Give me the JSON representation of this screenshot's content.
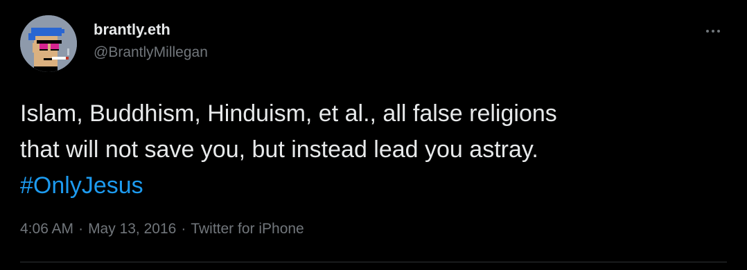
{
  "tweet": {
    "author": {
      "display_name": "brantly.eth",
      "handle": "@BrantlyMillegan",
      "avatar_icon": "pixel-punk-avatar-icon"
    },
    "more_icon": "more-horizontal-icon",
    "text_lines": [
      "Islam, Buddhism, Hinduism, et al., all false religions",
      "that will not save you, but instead lead you astray."
    ],
    "hashtag": "#OnlyJesus",
    "meta": {
      "time": "4:06 AM",
      "separator": "·",
      "date": "May 13, 2016",
      "source": "Twitter for iPhone"
    },
    "colors": {
      "background": "#000000",
      "text": "#e7e9ea",
      "secondary_text": "#71767b",
      "link": "#1d9bf0",
      "divider": "#2f3336"
    }
  }
}
